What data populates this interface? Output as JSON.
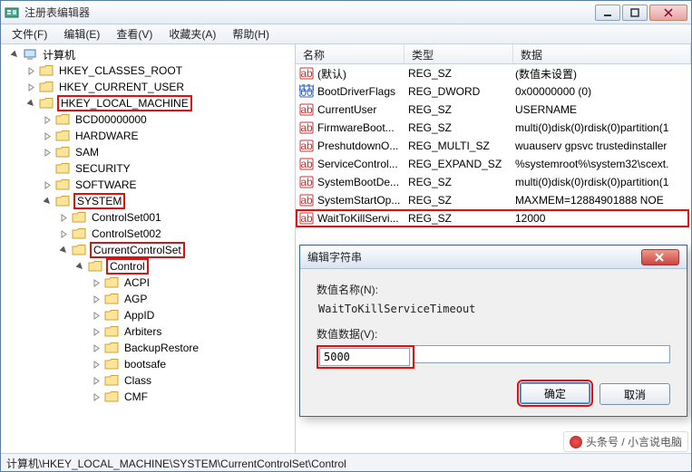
{
  "window": {
    "title": "注册表编辑器"
  },
  "menu": {
    "file": "文件(F)",
    "edit": "编辑(E)",
    "view": "查看(V)",
    "fav": "收藏夹(A)",
    "help": "帮助(H)"
  },
  "tree": {
    "root": "计算机",
    "hkcr": "HKEY_CLASSES_ROOT",
    "hkcu": "HKEY_CURRENT_USER",
    "hklm": "HKEY_LOCAL_MACHINE",
    "bcd": "BCD00000000",
    "hw": "HARDWARE",
    "sam": "SAM",
    "sec": "SECURITY",
    "sw": "SOFTWARE",
    "sys": "SYSTEM",
    "cs1": "ControlSet001",
    "cs2": "ControlSet002",
    "ccs": "CurrentControlSet",
    "ctrl": "Control",
    "acpi": "ACPI",
    "agp": "AGP",
    "appid": "AppID",
    "arb": "Arbiters",
    "bkr": "BackupRestore",
    "boot": "bootsafe",
    "class": "Class",
    "cmf": "CMF"
  },
  "cols": {
    "name": "名称",
    "type": "类型",
    "data": "数据"
  },
  "rows": [
    {
      "icon": "str",
      "name": "(默认)",
      "type": "REG_SZ",
      "data": "(数值未设置)"
    },
    {
      "icon": "bin",
      "name": "BootDriverFlags",
      "type": "REG_DWORD",
      "data": "0x00000000 (0)"
    },
    {
      "icon": "str",
      "name": "CurrentUser",
      "type": "REG_SZ",
      "data": "USERNAME"
    },
    {
      "icon": "str",
      "name": "FirmwareBoot...",
      "type": "REG_SZ",
      "data": "multi(0)disk(0)rdisk(0)partition(1"
    },
    {
      "icon": "str",
      "name": "PreshutdownO...",
      "type": "REG_MULTI_SZ",
      "data": "wuauserv gpsvc trustedinstaller"
    },
    {
      "icon": "str",
      "name": "ServiceControl...",
      "type": "REG_EXPAND_SZ",
      "data": "%systemroot%\\system32\\scext."
    },
    {
      "icon": "str",
      "name": "SystemBootDe...",
      "type": "REG_SZ",
      "data": "multi(0)disk(0)rdisk(0)partition(1"
    },
    {
      "icon": "str",
      "name": "SystemStartOp...",
      "type": "REG_SZ",
      "data": " MAXMEM=12884901888  NOE"
    },
    {
      "icon": "str",
      "name": "WaitToKillServi...",
      "type": "REG_SZ",
      "data": "12000",
      "hl": true
    }
  ],
  "dialog": {
    "title": "编辑字符串",
    "nameLabel": "数值名称(N):",
    "nameValue": "WaitToKillServiceTimeout",
    "dataLabel": "数值数据(V):",
    "dataValue": "5000",
    "ok": "确定",
    "cancel": "取消"
  },
  "status": "计算机\\HKEY_LOCAL_MACHINE\\SYSTEM\\CurrentControlSet\\Control",
  "watermark": "头条号 / 小言说电脑"
}
